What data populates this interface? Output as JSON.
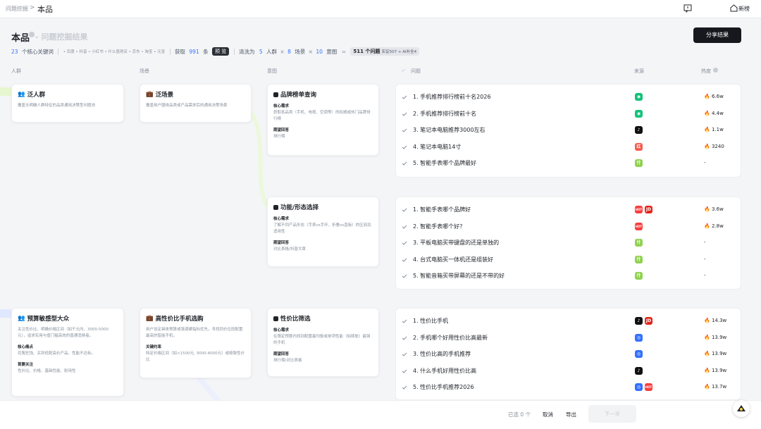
{
  "breadcrumb": {
    "root": "问题挖掘",
    "separator": ">",
    "current": "本品"
  },
  "header": {
    "new_label": "新榜",
    "home_icon": "home-icon",
    "message_icon": "message-icon"
  },
  "page": {
    "title": "本品",
    "subtitle": "- 问题挖掘结果",
    "share_label": "分享结果"
  },
  "stats": {
    "keywords_count": "23",
    "keywords_label": "个核心关键词",
    "sources": "• 百度 • 抖音 • 小红书 • 什么值得买 • 京东 • 淘宝 • 元宝",
    "fetch_label": "获取",
    "fetch_count": "991",
    "fetch_unit": "条",
    "preview_label": "预 览",
    "clean_label": "清洗为",
    "crowd_count": "5",
    "crowd_label": "人群",
    "scene_count": "8",
    "scene_label": "场景",
    "intent_count": "10",
    "intent_label": "意图",
    "times": "×",
    "questions_count_label": "511 个问题",
    "questions_detail": "实证507 + AI补全4"
  },
  "columns": {
    "crowd": "人群",
    "scene": "场景",
    "intent": "意图",
    "question": "问题",
    "source": "来源",
    "heat": "热度"
  },
  "cards": {
    "crowd1": {
      "title": "泛人群",
      "desc": "覆盖无明确人群特征的品类通用决策型问题池"
    },
    "scene1": {
      "title": "泛场景",
      "desc": "覆盖用户围绕品类或产品需求后的通用决策场景"
    },
    "intent1": {
      "title": "品牌榜单查询",
      "core_label": "核心需求",
      "core_text": "获取各品类（手机、电视、空调等）的权威或热门品牌排行榜",
      "expect_label": "期望回答",
      "expect_text": "排行榜"
    },
    "intent2": {
      "title": "功能/形态选择",
      "core_label": "核心需求",
      "core_text": "了解不同产品形态（手表vs手环、折叠vs直板）的区别及适用性",
      "expect_label": "期望回答",
      "expect_text": "对比表格/科普文章"
    },
    "crowd2": {
      "title": "预算敏感型大众",
      "desc": "关注性价比、明确价格区间（如千元内、3000-5000元），追求实用与值门槛高效的普通消费者。",
      "core_label": "核心痛点",
      "core_text": "花冤枉钱、买到低配高价产品、性能不达标。",
      "focus_label": "首要关注",
      "focus_text": "性价比、价格、基础性能、耐用性"
    },
    "scene2": {
      "title": "高性价比手机选购",
      "desc": "用户设定具体预算或强调硬指标优先，寻找同价位段配置最高的智能手机。",
      "key_label": "关键约束",
      "key_text": "特定价格区间（如<1500元, 3000-4000元）或极致性价比"
    },
    "intent3": {
      "title": "性价比筛选",
      "core_label": "核心需求",
      "core_text": "在限定预算内找到配置最均衡或单项性能（如续航）最强的手机",
      "expect_label": "期望回答",
      "expect_text": "排行榜/对比表格"
    }
  },
  "questions": {
    "group1": [
      {
        "text": "1. 手机推荐排行榜前十名2026",
        "heat": "6.6w",
        "sources": [
          "chat-icon"
        ]
      },
      {
        "text": "2. 手机推荐排行榜前十名",
        "heat": "4.4w",
        "sources": [
          "chat-icon"
        ]
      },
      {
        "text": "3. 笔记本电脑推荐3000左右",
        "heat": "1.1w",
        "sources": [
          "tiktok-icon"
        ]
      },
      {
        "text": "4. 笔记本电脑14寸",
        "heat": "3240",
        "sources": [
          "xiaohongshu-icon"
        ]
      },
      {
        "text": "5. 智能手表哪个品牌最好",
        "heat": "-",
        "sources": [
          "smzdm-icon"
        ]
      }
    ],
    "group2": [
      {
        "text": "1. 智能手表哪个品牌好",
        "heat": "3.6w",
        "sources": [
          "redtag-icon",
          "jd-icon"
        ]
      },
      {
        "text": "2. 智能手表哪个好?",
        "heat": "2.8w",
        "sources": [
          "redtag-icon"
        ]
      },
      {
        "text": "3. 平板电脑买带键盘的还是单独的",
        "heat": "-",
        "sources": [
          "smzdm-icon"
        ]
      },
      {
        "text": "4. 台式电脑买一体机还是组装好",
        "heat": "-",
        "sources": [
          "smzdm-icon"
        ]
      },
      {
        "text": "5. 智能音箱买带屏幕的还是不带的好",
        "heat": "-",
        "sources": [
          "smzdm-icon"
        ]
      }
    ],
    "group3": [
      {
        "text": "1. 性价比手机",
        "heat": "14.3w",
        "sources": [
          "tiktok-icon",
          "jd-icon"
        ]
      },
      {
        "text": "2. 手机哪个好用性价比高最新",
        "heat": "13.9w",
        "sources": [
          "baidu-icon"
        ]
      },
      {
        "text": "3. 性价比高的手机推荐",
        "heat": "13.9w",
        "sources": [
          "baidu-icon"
        ]
      },
      {
        "text": "4. 什么手机好用性价比高",
        "heat": "13.9w",
        "sources": [
          "tiktok-icon"
        ]
      },
      {
        "text": "5. 性价比手机推荐2026",
        "heat": "13.7w",
        "sources": [
          "baidu-icon",
          "redtag-icon"
        ]
      }
    ]
  },
  "source_labels": {
    "jd": "JD",
    "redtag": "HOT",
    "smzdm": "什",
    "xiaohongshu": "红"
  },
  "bottom": {
    "selected_label": "已选 0 个",
    "cancel_label": "取消",
    "export_label": "导出",
    "next_label": "下一步"
  },
  "colors": {
    "accent": "#3370ff",
    "flame": "#f53f3f",
    "green": "#13c27a",
    "lime": "#8fd14f"
  }
}
